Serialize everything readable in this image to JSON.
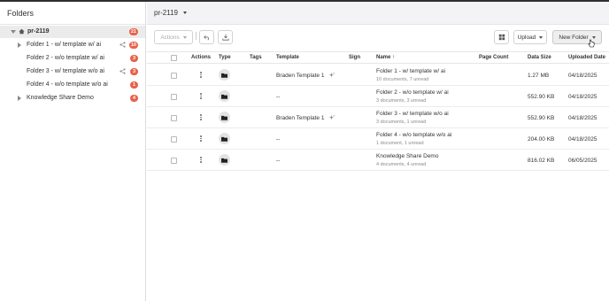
{
  "sidebar": {
    "title": "Folders",
    "root": {
      "label": "pr-2119",
      "badge": "21"
    },
    "items": [
      {
        "label": "Folder 1 - w/ template w/ ai",
        "badge": "10",
        "shared": true,
        "expandable": true
      },
      {
        "label": "Folder 2 - w/o template w/ ai",
        "badge": "3",
        "shared": false,
        "expandable": false
      },
      {
        "label": "Folder 3 - w/ template w/o ai",
        "badge": "3",
        "shared": true,
        "expandable": false
      },
      {
        "label": "Folder 4 - w/o template w/o ai",
        "badge": "1",
        "shared": false,
        "expandable": false
      },
      {
        "label": "Knowledge Share Demo",
        "badge": "4",
        "shared": false,
        "expandable": true
      }
    ]
  },
  "header": {
    "title": "pr-2119"
  },
  "toolbar": {
    "actions_label": "Actions",
    "upload_label": "Upload",
    "new_folder_label": "New Folder"
  },
  "table": {
    "columns": {
      "actions": "Actions",
      "type": "Type",
      "tags": "Tags",
      "template": "Template",
      "sign": "Sign",
      "name": "Name",
      "name_sort": "↑",
      "page_count": "Page Count",
      "data_size": "Data Size",
      "uploaded_date": "Uploaded Date"
    },
    "rows": [
      {
        "template": "Braden Template 1",
        "template_ai": true,
        "name": "Folder 1 - w/ template w/ ai",
        "sub": "10 documents, 7 unread",
        "data_size": "1.27 MB",
        "uploaded": "04/18/2025"
      },
      {
        "template": "--",
        "template_ai": false,
        "name": "Folder 2 - w/o template w/ ai",
        "sub": "3 documents, 3 unread",
        "data_size": "552.90 KB",
        "uploaded": "04/18/2025"
      },
      {
        "template": "Braden Template 1",
        "template_ai": true,
        "name": "Folder 3 - w/ template w/o ai",
        "sub": "3 documents, 1 unread",
        "data_size": "552.90 KB",
        "uploaded": "04/18/2025"
      },
      {
        "template": "--",
        "template_ai": false,
        "name": "Folder 4 - w/o template w/o ai",
        "sub": "1 document, 1 unread",
        "data_size": "204.00 KB",
        "uploaded": "04/18/2025"
      },
      {
        "template": "--",
        "template_ai": false,
        "name": "Knowledge Share Demo",
        "sub": "4 documents, 4 unread",
        "data_size": "816.02 KB",
        "uploaded": "06/05/2025"
      }
    ]
  },
  "colors": {
    "badge": "#e8624a",
    "header_bg": "#f3f3f5",
    "selected_row": "#ebebeb"
  }
}
